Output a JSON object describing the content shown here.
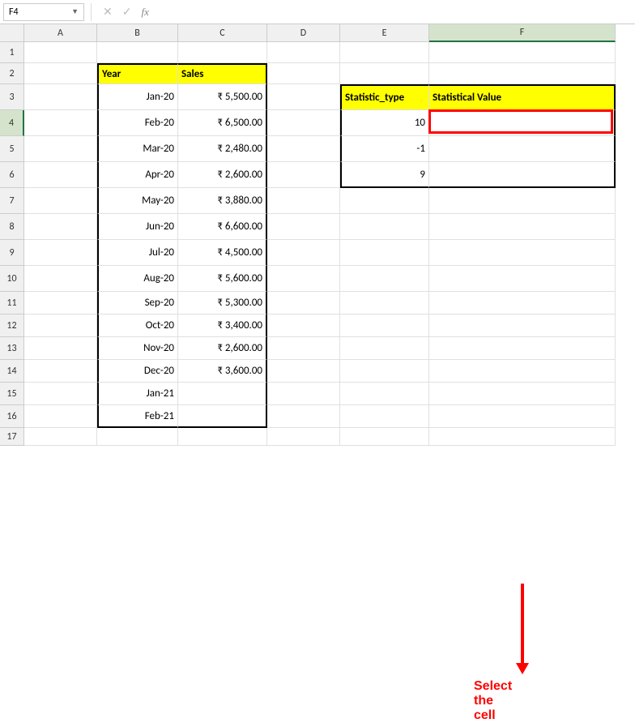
{
  "namebox": "F4",
  "formula_input": "",
  "columns": [
    "A",
    "B",
    "C",
    "D",
    "E",
    "F"
  ],
  "col_widths": {
    "A": 90,
    "B": 100,
    "C": 110,
    "D": 90,
    "E": 110,
    "F": 230
  },
  "rows_count": 17,
  "row_heights": {
    "1": 26,
    "2": 26,
    "3": 32,
    "4": 32,
    "5": 32,
    "6": 32,
    "7": 32,
    "8": 32,
    "9": 32,
    "10": 32,
    "11": 28,
    "12": 28,
    "13": 28,
    "14": 28,
    "15": 28,
    "16": 28,
    "17": 22
  },
  "selected_cell": {
    "col": "F",
    "row": 4
  },
  "table1": {
    "header": {
      "year": "Year",
      "sales": "Sales"
    },
    "rows": [
      {
        "year": "Jan-20",
        "sales": "₹ 5,500.00"
      },
      {
        "year": "Feb-20",
        "sales": "₹ 6,500.00"
      },
      {
        "year": "Mar-20",
        "sales": "₹ 2,480.00"
      },
      {
        "year": "Apr-20",
        "sales": "₹ 2,600.00"
      },
      {
        "year": "May-20",
        "sales": "₹ 3,880.00"
      },
      {
        "year": "Jun-20",
        "sales": "₹ 6,600.00"
      },
      {
        "year": "Jul-20",
        "sales": "₹ 4,500.00"
      },
      {
        "year": "Aug-20",
        "sales": "₹ 5,600.00"
      },
      {
        "year": "Sep-20",
        "sales": "₹ 5,300.00"
      },
      {
        "year": "Oct-20",
        "sales": "₹ 3,400.00"
      },
      {
        "year": "Nov-20",
        "sales": "₹ 2,600.00"
      },
      {
        "year": "Dec-20",
        "sales": "₹ 3,600.00"
      },
      {
        "year": "Jan-21",
        "sales": ""
      },
      {
        "year": "Feb-21",
        "sales": ""
      }
    ]
  },
  "table2": {
    "header": {
      "stat_type": "Statistic_type",
      "stat_value": "Statistical Value"
    },
    "rows": [
      {
        "stat_type": "10",
        "stat_value": ""
      },
      {
        "stat_type": "-1",
        "stat_value": ""
      },
      {
        "stat_type": "9",
        "stat_value": ""
      }
    ]
  },
  "annotation": "Select the cell"
}
